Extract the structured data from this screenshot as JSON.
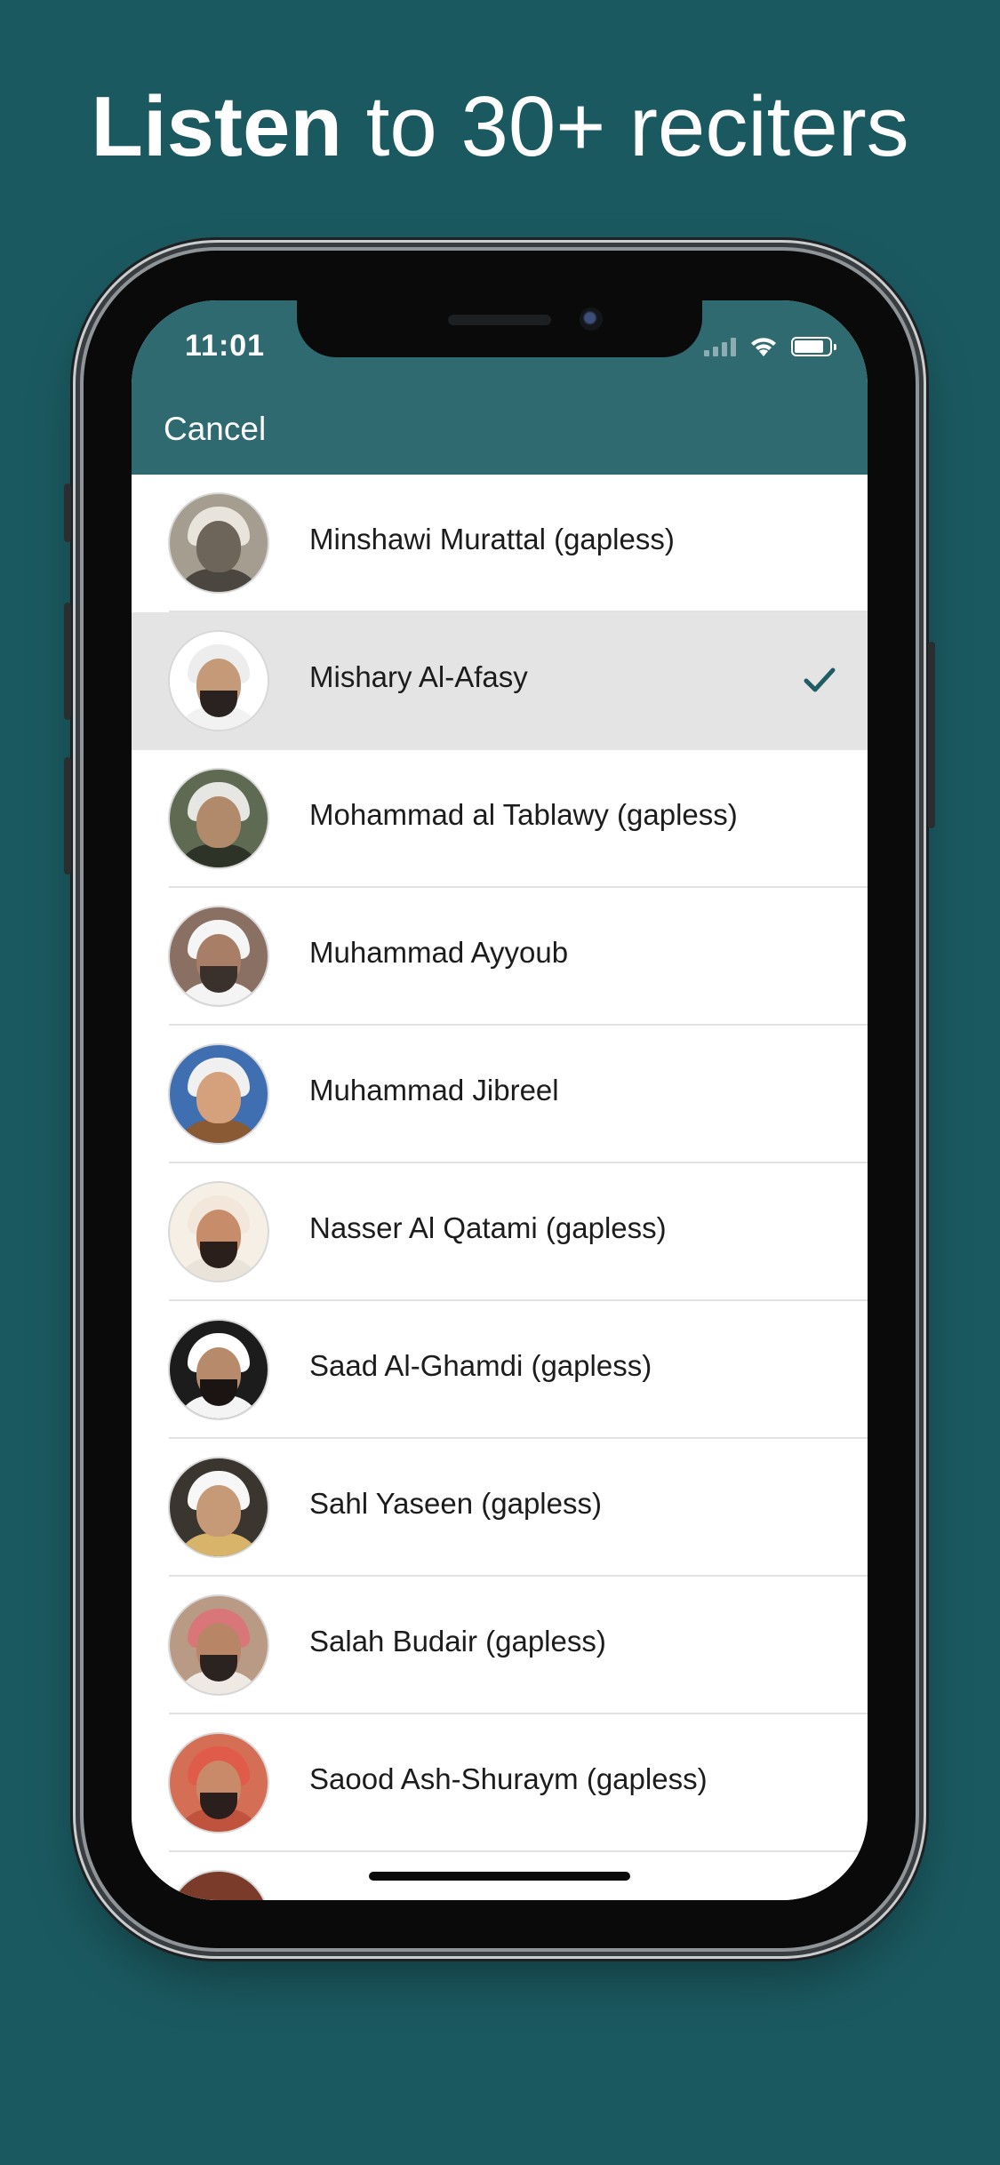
{
  "headline": {
    "strong": "Listen",
    "rest": " to 30+ reciters"
  },
  "status_bar": {
    "time": "11:01",
    "icons": [
      "signal-icon",
      "wifi-icon",
      "battery-icon"
    ],
    "battery_level": 0.85
  },
  "nav": {
    "cancel_label": "Cancel"
  },
  "colors": {
    "background": "#1b5960",
    "navbar": "#2f6a71",
    "check": "#1f5c63",
    "selected_row": "#e4e4e4"
  },
  "reciters": [
    {
      "name": "Minshawi Murattal (gapless)",
      "selected": false
    },
    {
      "name": "Mishary Al-Afasy",
      "selected": true
    },
    {
      "name": "Mohammad al Tablawy (gapless)",
      "selected": false
    },
    {
      "name": "Muhammad Ayyoub",
      "selected": false
    },
    {
      "name": "Muhammad Jibreel",
      "selected": false
    },
    {
      "name": "Nasser Al Qatami (gapless)",
      "selected": false
    },
    {
      "name": "Saad Al-Ghamdi (gapless)",
      "selected": false
    },
    {
      "name": "Sahl Yaseen (gapless)",
      "selected": false
    },
    {
      "name": "Salah Budair (gapless)",
      "selected": false
    },
    {
      "name": "Saood Ash-Shuraym (gapless)",
      "selected": false
    }
  ]
}
